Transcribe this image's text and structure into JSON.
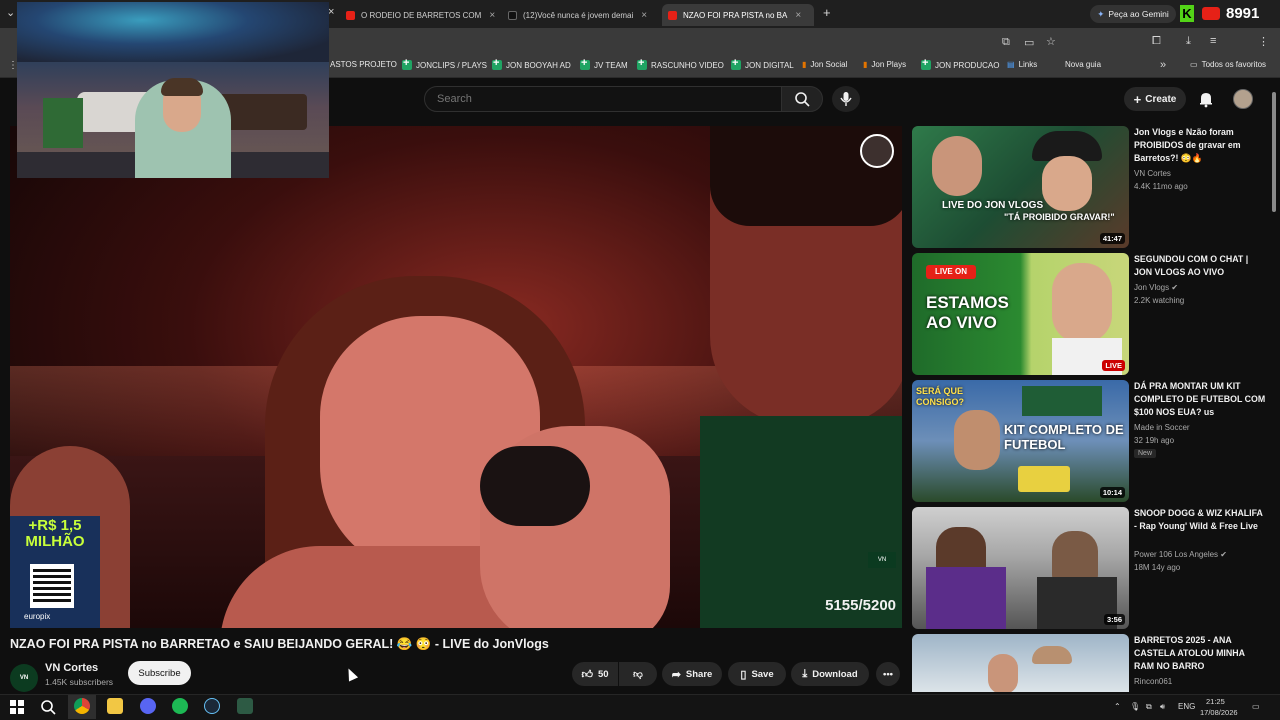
{
  "browser": {
    "tabs": [
      {
        "label": "O RODEIO DE BARRETOS COM",
        "active": false
      },
      {
        "label": "(12)Você nunca é jovem demai",
        "active": false
      },
      {
        "label": "NZAO FOI PRA PISTA no BA",
        "active": true
      }
    ],
    "new_tab_label": "+",
    "gemini_label": "Peça ao Gemini",
    "counter_text": "8991",
    "bookmarks": [
      "ASTOS PROJETO",
      "JONCLIPS / PLAYS",
      "JON BOOYAH AD",
      "JV TEAM",
      "RASCUNHO VIDEO",
      "JON DIGITAL",
      "Jon Social",
      "Jon Plays",
      "JON PRODUCAO",
      "Links",
      "Nova guia"
    ],
    "all_bookmarks_label": "Todos os favoritos"
  },
  "youtube": {
    "search_placeholder": "Search",
    "create_label": "Create"
  },
  "player": {
    "promo_amount": "+R$ 1,5 MILHÃO",
    "promo_brand": "europix",
    "counter": "5155/5200"
  },
  "video": {
    "title": "NZAO FOI PRA PISTA no BARRETAO e SAIU BEIJANDO GERAL! 😂 😳 - LIVE do JonVlogs",
    "channel_name": "VN Cortes",
    "channel_subs": "1.45K subscribers",
    "subscribe_label": "Subscribe",
    "likes": "50",
    "share_label": "Share",
    "save_label": "Save",
    "download_label": "Download"
  },
  "recommendations": [
    {
      "title": "Jon Vlogs e Nzão foram PROIBIDOS de gravar em Barretos?! 😳🔥",
      "channel": "VN Cortes",
      "meta": "4.4K  11mo ago",
      "duration": "41:47",
      "thumb_text": "\"TÁ PROIBIDO GRAVAR!\"",
      "thumb_sub": "LIVE DO JON VLOGS"
    },
    {
      "title": "SEGUNDOU COM O CHAT | JON VLOGS AO VIVO",
      "channel": "Jon Vlogs ✔",
      "meta": "2.2K watching",
      "duration": "LIVE",
      "thumb_text": "ESTAMOS AO VIVO",
      "thumb_sub": "LIVE ON"
    },
    {
      "title": "DÁ PRA MONTAR UM KIT COMPLETO DE FUTEBOL COM $100 NOS EUA? us",
      "channel": "Made in Soccer",
      "meta": "32  19h ago",
      "duration": "10:14",
      "badge": "New",
      "thumb_text": "KIT COMPLETO DE FUTEBOL",
      "thumb_sub": "SERÁ QUE CONSIGO?"
    },
    {
      "title": "SNOOP DOGG & WIZ KHALIFA - Rap Young' Wild & Free Live",
      "channel": "Power 106 Los Angeles ✔",
      "meta": "18M  14y ago",
      "duration": "3:56"
    },
    {
      "title": "BARRETOS 2025 - ANA CASTELA ATOLOU MINHA RAM NO BARRO",
      "channel": "Rincon061",
      "meta": ""
    }
  ],
  "taskbar": {
    "lang": "ENG",
    "time": "21:25",
    "date": "17/08/2026"
  }
}
